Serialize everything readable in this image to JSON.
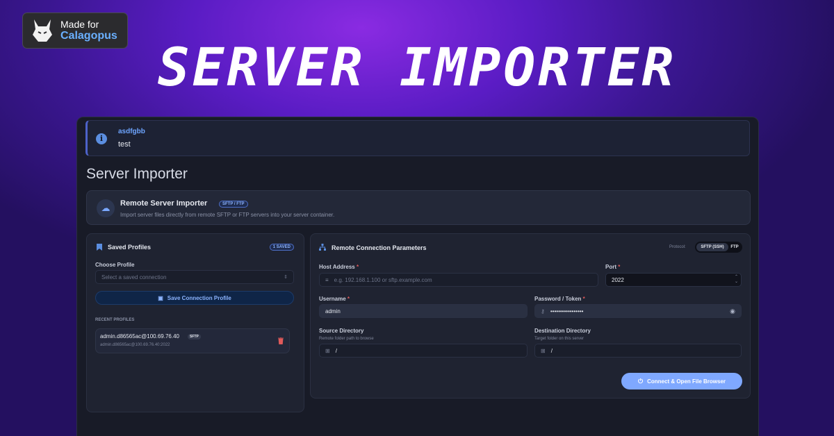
{
  "badge": {
    "line1": "Made for",
    "line2": "Calagopus"
  },
  "headline": "SERVER IMPORTER",
  "alert": {
    "title": "asdfgbb",
    "message": "test",
    "icon": "info-icon"
  },
  "page_title": "Server Importer",
  "hero": {
    "title": "Remote Server Importer",
    "tag": "SFTP / FTP",
    "subtitle": "Import server files directly from remote SFTP or FTP servers into your server container.",
    "icon": "cloud-download-icon"
  },
  "profiles": {
    "title": "Saved Profiles",
    "count_badge": "1 SAVED",
    "choose_label": "Choose Profile",
    "select_placeholder": "Select a saved connection",
    "save_button": "Save Connection Profile",
    "recent_heading": "RECENT PROFILES",
    "recent": [
      {
        "name": "admin.d86565ac@100.69.76.40",
        "protocol": "SFTP",
        "detail": "admin.d86565ac@100.69.76.40:2022"
      }
    ]
  },
  "connection": {
    "title": "Remote Connection Parameters",
    "protocol_label": "Protocol:",
    "protocol_options": [
      "SFTP (SSH)",
      "FTP"
    ],
    "protocol_selected": "SFTP (SSH)",
    "host_label": "Host Address",
    "host_placeholder": "e.g. 192.168.1.100 or sftp.example.com",
    "port_label": "Port",
    "port_value": "2022",
    "username_label": "Username",
    "username_value": "admin",
    "password_label": "Password / Token",
    "password_value": "•••••••••••••••••",
    "source_label": "Source Directory",
    "source_hint": "Remote folder path to browse",
    "source_value": "/",
    "dest_label": "Destination Directory",
    "dest_hint": "Target folder on this server",
    "dest_value": "/",
    "connect_button": "Connect & Open File Browser",
    "required_mark": "*"
  },
  "colors": {
    "accent": "#5b8ee0",
    "button": "#7fa8ff",
    "danger": "#e05a5a"
  }
}
